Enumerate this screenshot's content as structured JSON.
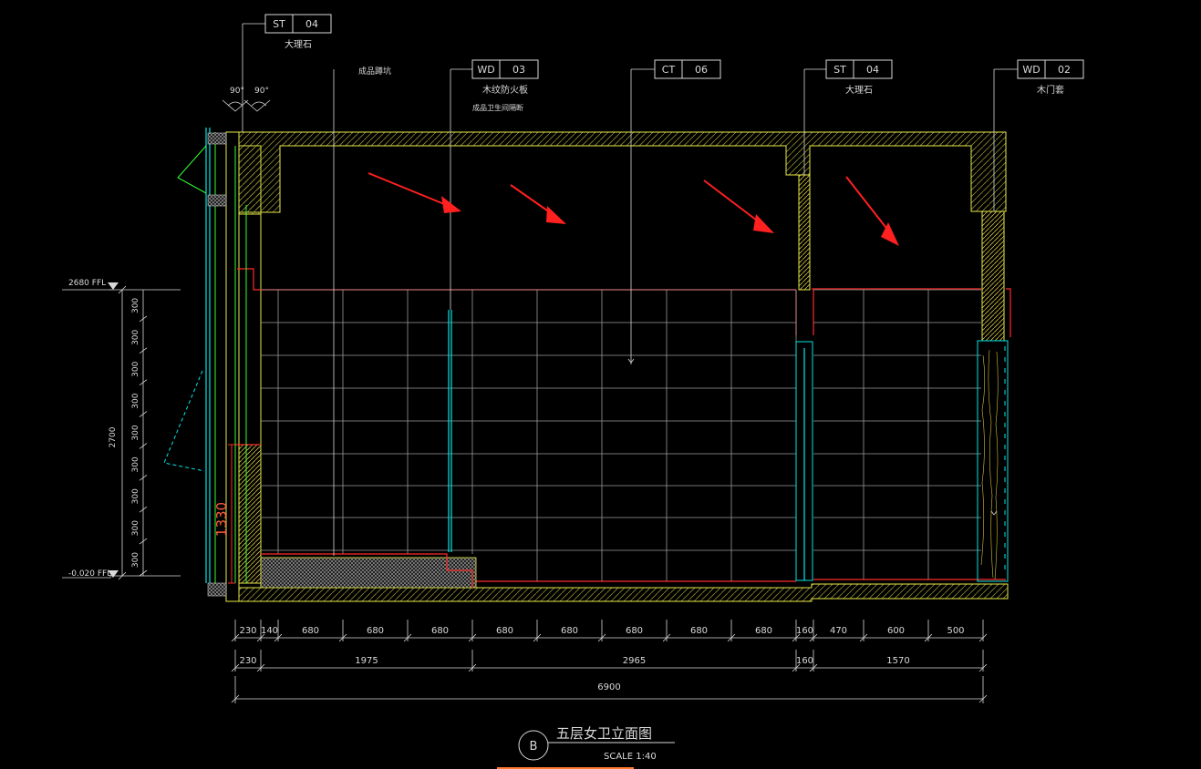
{
  "tags": [
    {
      "code": "ST",
      "num": "04",
      "desc": "大理石"
    },
    {
      "code": "WD",
      "num": "03",
      "desc": "木纹防火板",
      "desc2": "成品卫生间隔断"
    },
    {
      "code": "CT",
      "num": "06",
      "desc": ""
    },
    {
      "code": "ST",
      "num": "04",
      "desc": "大理石"
    },
    {
      "code": "WD",
      "num": "02",
      "desc": "木门套"
    }
  ],
  "fixture_note": "成品蹲坑",
  "angle_left": "90°",
  "angle_right": "90°",
  "levels": {
    "top": "2680 FFL",
    "bottom": "-0.020 FFL"
  },
  "left_dims": {
    "segments": [
      "300",
      "300",
      "300",
      "300",
      "300",
      "300",
      "300",
      "300",
      "300"
    ],
    "total": "2700"
  },
  "partition_height": "1330",
  "dim_row1": [
    "230",
    "140",
    "680",
    "680",
    "680",
    "680",
    "680",
    "680",
    "680",
    "680",
    "160",
    "470",
    "600",
    "500"
  ],
  "dim_row2": [
    "230",
    "1975",
    "2965",
    "160",
    "1570"
  ],
  "dim_total": "6900",
  "title": {
    "badge": "B",
    "text": "五层女卫立面图",
    "scale": "SCALE  1:40"
  },
  "colors": {
    "wall": "#e8e84a",
    "grid": "#bbbbbb",
    "red": "#ff2a2a",
    "cyan": "#00e5e5",
    "green": "#33ff33",
    "dim": "#d9d9d9",
    "arrow": "#ff2020"
  }
}
